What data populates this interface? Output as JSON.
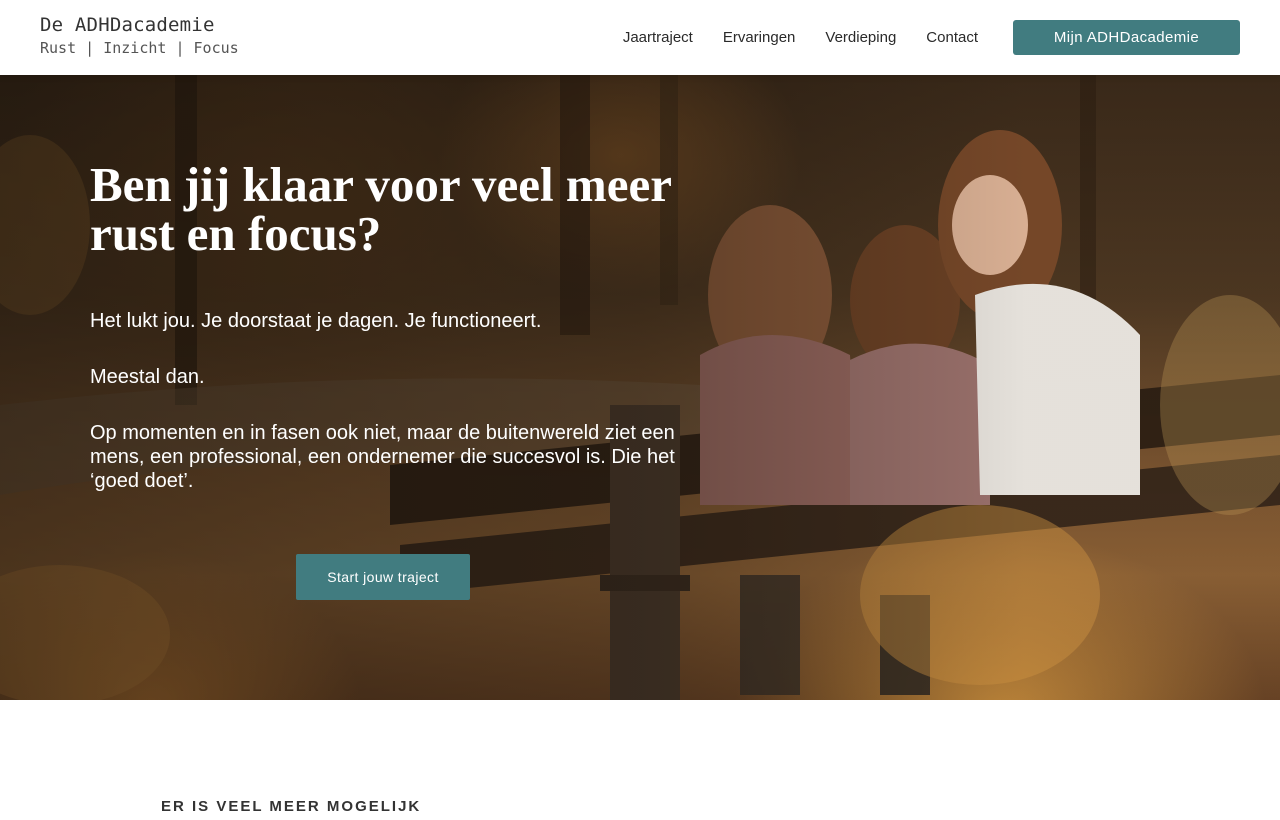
{
  "header": {
    "logo_title": "De ADHDacademie",
    "logo_tagline": "Rust | Inzicht | Focus",
    "nav": [
      {
        "label": "Jaartraject"
      },
      {
        "label": "Ervaringen"
      },
      {
        "label": "Verdieping"
      },
      {
        "label": "Contact"
      }
    ],
    "cta_label": "Mijn ADHDacademie"
  },
  "hero": {
    "title": "Ben jij klaar voor veel meer rust en focus?",
    "paragraphs": [
      "Het lukt jou. Je doorstaat je dagen. Je functioneert.",
      "Meestal dan.",
      "Op momenten en in fasen ook niet, maar de buitenwereld ziet een mens, een professional, een ondernemer die succesvol is. Die het ‘goed doet’."
    ],
    "cta_label": "Start jouw traject"
  },
  "section": {
    "eyebrow": "ER IS VEEL MEER MOGELIJK"
  },
  "colors": {
    "accent": "#417c80",
    "header_bg": "#ffffff",
    "hero_text": "#ffffff"
  }
}
